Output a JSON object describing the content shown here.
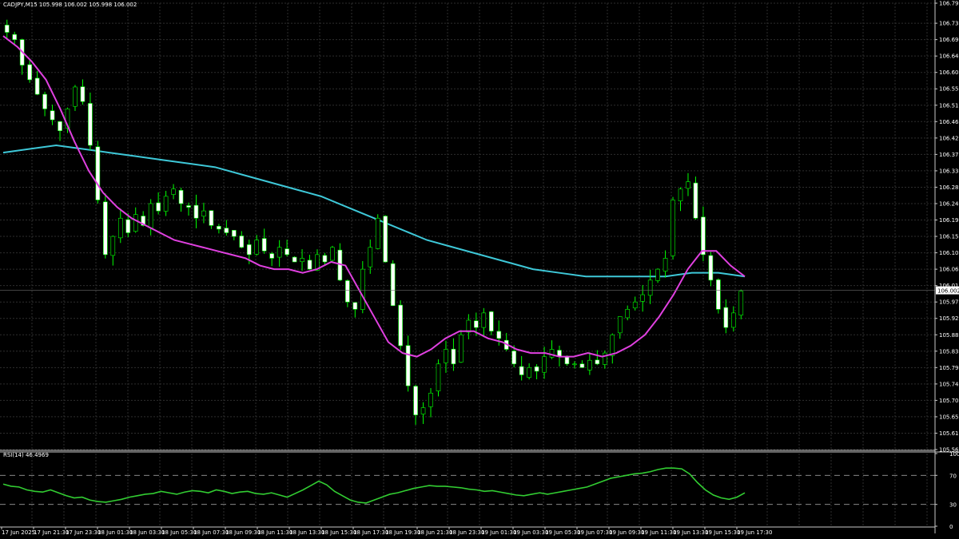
{
  "header": {
    "symbol_line": "CADJPY,M15  105.998 106.002 105.998 106.002"
  },
  "colors": {
    "background": "#000000",
    "grid": "#2e2e2e",
    "bull_body": "#000000",
    "bull_outline": "#00ff00",
    "bear_body": "#ffffff",
    "bear_outline": "#00ff00",
    "ma_fast": "#e040e0",
    "ma_slow": "#3ec8d8",
    "rsi_line": "#32cd32",
    "price_label_bg": "#ffffff"
  },
  "rsi_panel": {
    "label": "RSI(14) 46.4969",
    "ylim": [
      0,
      100
    ],
    "scale_labels": [
      "100",
      "70",
      "30",
      "0"
    ],
    "levels": [
      70,
      30
    ]
  },
  "chart_data": [
    {
      "type": "candlestick",
      "title": "CADJPY,M15",
      "ylim": [
        105.565,
        106.79
      ],
      "y_ticks": [
        "106.790",
        "106.735",
        "106.690",
        "106.645",
        "106.600",
        "106.555",
        "106.510",
        "106.465",
        "106.420",
        "106.375",
        "106.330",
        "106.285",
        "106.240",
        "106.195",
        "106.150",
        "106.105",
        "106.060",
        "106.015",
        "105.970",
        "105.925",
        "105.880",
        "105.835",
        "105.790",
        "105.745",
        "105.700",
        "105.655",
        "105.610",
        "105.565"
      ],
      "y_tick_values": [
        106.79,
        106.735,
        106.69,
        106.645,
        106.6,
        106.555,
        106.51,
        106.465,
        106.42,
        106.375,
        106.33,
        106.285,
        106.24,
        106.195,
        106.15,
        106.105,
        106.06,
        106.015,
        105.97,
        105.925,
        105.88,
        105.835,
        105.79,
        105.745,
        105.7,
        105.655,
        105.61,
        105.565
      ],
      "current_price": "106.002",
      "current_price_value": 106.002,
      "x_ticks": [
        "17 Jun 2025",
        "17 Jun 21:30",
        "17 Jun 23:30",
        "18 Jun 01:30",
        "18 Jun 03:30",
        "18 Jun 05:30",
        "18 Jun 07:30",
        "18 Jun 09:30",
        "18 Jun 11:30",
        "18 Jun 13:30",
        "18 Jun 15:30",
        "18 Jun 17:30",
        "18 Jun 19:30",
        "18 Jun 21:30",
        "18 Jun 23:30",
        "19 Jun 01:30",
        "19 Jun 03:30",
        "19 Jun 05:30",
        "19 Jun 07:30",
        "19 Jun 09:30",
        "19 Jun 11:30",
        "19 Jun 13:30",
        "19 Jun 15:30",
        "19 Jun 17:30"
      ],
      "close_series": [
        106.71,
        106.69,
        106.62,
        106.58,
        106.54,
        106.5,
        106.47,
        106.44,
        106.5,
        106.56,
        106.52,
        106.4,
        106.25,
        106.1,
        106.15,
        106.2,
        106.16,
        106.21,
        106.18,
        106.24,
        106.22,
        106.26,
        106.28,
        106.24,
        106.23,
        106.2,
        106.22,
        106.18,
        106.17,
        106.16,
        106.15,
        106.12,
        106.1,
        106.14,
        106.11,
        106.09,
        106.12,
        106.1,
        106.08,
        106.09,
        106.06,
        106.1,
        106.08,
        106.12,
        106.03,
        105.97,
        105.95,
        106.06,
        106.12,
        106.2,
        106.08,
        105.96,
        105.85,
        105.74,
        105.66,
        105.68,
        105.72,
        105.8,
        105.84,
        105.8,
        105.88,
        105.92,
        105.9,
        105.94,
        105.89,
        105.87,
        105.84,
        105.8,
        105.77,
        105.79,
        105.78,
        105.82,
        105.84,
        105.82,
        105.8,
        105.8,
        105.79,
        105.81,
        105.8,
        105.83,
        105.88,
        105.93,
        105.95,
        105.97,
        105.99,
        106.03,
        106.06,
        106.09,
        106.25,
        106.28,
        106.3,
        106.2,
        106.1,
        106.03,
        105.95,
        105.9,
        105.94,
        106.0
      ],
      "ma_fast": [
        106.7,
        106.67,
        106.63,
        106.58,
        106.5,
        106.41,
        106.33,
        106.27,
        106.23,
        106.2,
        106.18,
        106.16,
        106.14,
        106.13,
        106.12,
        106.11,
        106.1,
        106.09,
        106.07,
        106.06,
        106.06,
        106.05,
        106.06,
        106.08,
        106.07,
        106.0,
        105.93,
        105.86,
        105.83,
        105.82,
        105.84,
        105.87,
        105.89,
        105.89,
        105.87,
        105.86,
        105.84,
        105.83,
        105.83,
        105.82,
        105.82,
        105.83,
        105.82,
        105.83,
        105.85,
        105.88,
        105.93,
        105.99,
        106.06,
        106.11,
        106.11,
        106.07,
        106.04
      ],
      "ma_slow": [
        106.38,
        106.39,
        106.4,
        106.39,
        106.38,
        106.37,
        106.36,
        106.35,
        106.34,
        106.32,
        106.3,
        106.28,
        106.26,
        106.23,
        106.2,
        106.17,
        106.14,
        106.12,
        106.1,
        106.08,
        106.06,
        106.05,
        106.04,
        106.04,
        106.04,
        106.04,
        106.05,
        106.05,
        106.04
      ]
    },
    {
      "type": "line",
      "title": "RSI(14)",
      "ylim": [
        0,
        100
      ],
      "values": [
        58,
        55,
        54,
        50,
        48,
        47,
        50,
        46,
        42,
        39,
        40,
        36,
        34,
        33,
        35,
        37,
        40,
        42,
        44,
        45,
        48,
        46,
        44,
        47,
        49,
        48,
        46,
        50,
        48,
        45,
        47,
        48,
        45,
        44,
        46,
        43,
        40,
        45,
        50,
        56,
        62,
        57,
        48,
        42,
        36,
        33,
        32,
        36,
        40,
        44,
        46,
        49,
        52,
        54,
        56,
        55,
        55,
        54,
        53,
        51,
        50,
        48,
        49,
        47,
        45,
        43,
        42,
        44,
        46,
        44,
        46,
        48,
        50,
        52,
        54,
        58,
        62,
        66,
        68,
        70,
        72,
        73,
        75,
        78,
        80,
        80,
        79,
        72,
        60,
        50,
        43,
        39,
        37,
        40,
        46
      ]
    }
  ]
}
